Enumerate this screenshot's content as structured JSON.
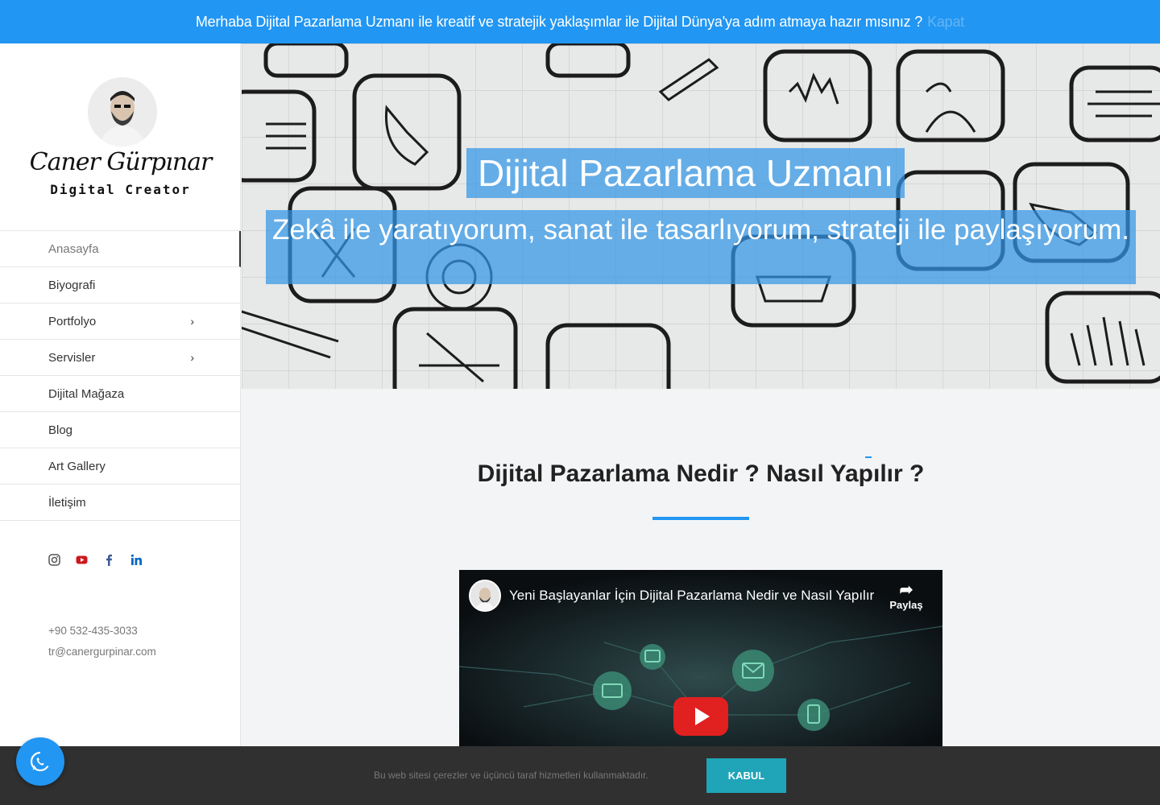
{
  "topbar": {
    "message": "Merhaba Dijital Pazarlama Uzmanı ile kreatif ve stratejik yaklaşımlar ile Dijital Dünya'ya adım atmaya hazır mısınız ?",
    "close_label": "Kapat"
  },
  "brand": {
    "signature": "Caner Gürpınar",
    "subtitle": "Digital Creator"
  },
  "nav": {
    "items": [
      {
        "label": "Anasayfa"
      },
      {
        "label": "Biyografi"
      },
      {
        "label": "Portfolyo"
      },
      {
        "label": "Servisler"
      },
      {
        "label": "Dijital Mağaza"
      },
      {
        "label": "Blog"
      },
      {
        "label": "Art Gallery"
      },
      {
        "label": "İletişim"
      }
    ]
  },
  "social": {
    "icons": [
      "instagram-icon",
      "youtube-icon",
      "facebook-icon",
      "linkedin-icon"
    ],
    "colors": {
      "youtube": "#cc181e",
      "linkedin": "#0a66c2",
      "instagram": "#555555",
      "facebook": "#3b5998"
    }
  },
  "contact": {
    "phone": "+90 532-435-3033",
    "email": "tr@canergurpinar.com"
  },
  "hero": {
    "title": "Dijital Pazarlama Uzmanı",
    "subtitle": "Zekâ ile yaratıyorum, sanat ile tasarlıyorum, strateji ile paylaşıyorum."
  },
  "section": {
    "title": "Dijital Pazarlama Nedir ? Nasıl Yapılır ?"
  },
  "video": {
    "title": "Yeni Başlayanlar İçin Dijital Pazarlama Nedir ve Nasıl Yapılır",
    "share_label": "Paylaş"
  },
  "cookie": {
    "text": "Bu web sitesi çerezler ve üçüncü taraf hizmetleri kullanmaktadır.",
    "accept_label": "KABUL"
  },
  "colors": {
    "accent": "#2196f3",
    "cookie_button": "#1fa4b8",
    "play_button": "#e12020"
  }
}
